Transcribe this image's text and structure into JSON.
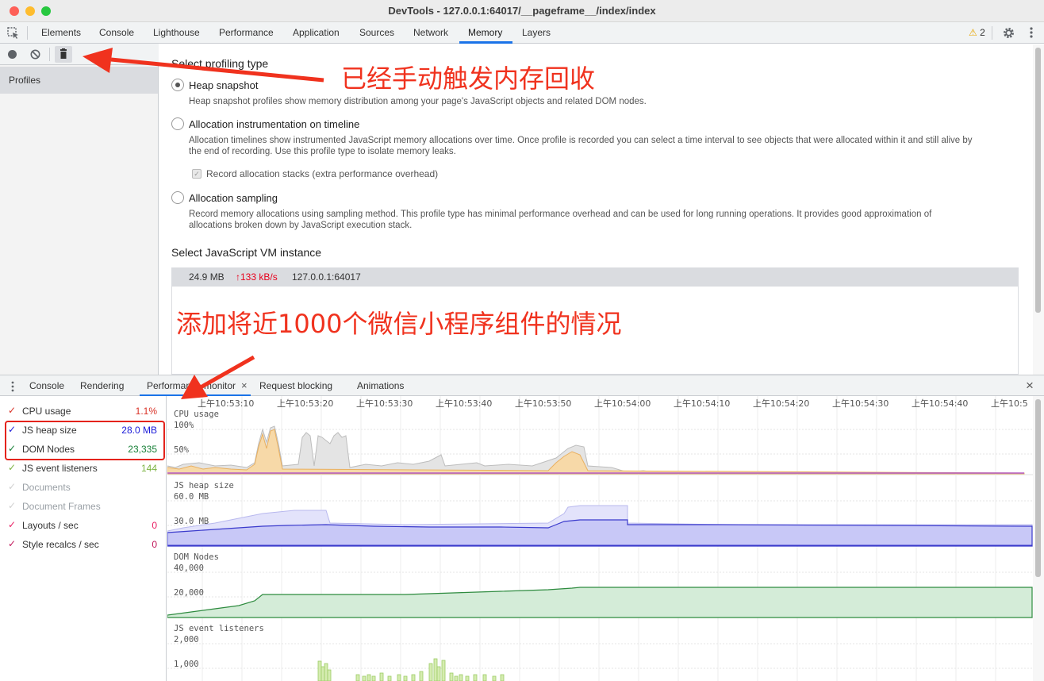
{
  "window": {
    "title": "DevTools - 127.0.0.1:64017/__pageframe__/index/index"
  },
  "main_tabs": [
    "Elements",
    "Console",
    "Lighthouse",
    "Performance",
    "Application",
    "Sources",
    "Network",
    "Memory",
    "Layers"
  ],
  "active_tab": "Memory",
  "warnings": {
    "count": "2"
  },
  "sidebar": {
    "profiles_label": "Profiles"
  },
  "memory": {
    "heading": "Select profiling type",
    "options": [
      {
        "label": "Heap snapshot",
        "checked": true,
        "desc": [
          "Heap snapshot profiles show memory distribution among your page's JavaScript objects and related DOM nodes."
        ]
      },
      {
        "label": "Allocation instrumentation on timeline",
        "checked": false,
        "desc": [
          "Allocation timelines show instrumented JavaScript memory allocations over time. Once profile is recorded you can select a time interval to see objects that were allocated within it and still alive by",
          "the end of recording. Use this profile type to isolate memory leaks."
        ]
      },
      {
        "label": "Allocation sampling",
        "checked": false,
        "desc": [
          "Record memory allocations using sampling method. This profile type has minimal performance overhead and can be used for long running operations. It provides good approximation of",
          "allocations broken down by JavaScript execution stack."
        ]
      }
    ],
    "record_stacks_label": "Record allocation stacks (extra performance overhead)",
    "vm_heading": "Select JavaScript VM instance",
    "vm": {
      "size": "24.9 MB",
      "rate": "↑133 kB/s",
      "host": "127.0.0.1:64017"
    }
  },
  "annotations": {
    "gc_note": "已经手动触发内存回收",
    "components_note": "添加将近1000个微信小程序组件的情况"
  },
  "drawer": {
    "tabs": [
      "Console",
      "Rendering",
      "Performance monitor",
      "Request blocking",
      "Animations"
    ],
    "active_tab": "Performance monitor"
  },
  "metrics": [
    {
      "label": "CPU usage",
      "value": "1.1%",
      "color": "#d93025",
      "enabled": true
    },
    {
      "label": "JS heap size",
      "value": "28.0 MB",
      "color": "#1a1ad9",
      "enabled": true
    },
    {
      "label": "DOM Nodes",
      "value": "23,335",
      "color": "#188038",
      "enabled": true
    },
    {
      "label": "JS event listeners",
      "value": "144",
      "color": "#7cb342",
      "enabled": true
    },
    {
      "label": "Documents",
      "value": "",
      "color": "#bbbbbb",
      "enabled": false
    },
    {
      "label": "Document Frames",
      "value": "",
      "color": "#bbbbbb",
      "enabled": false
    },
    {
      "label": "Layouts / sec",
      "value": "0",
      "color": "#e91e63",
      "enabled": true
    },
    {
      "label": "Style recalcs / sec",
      "value": "0",
      "color": "#c2185b",
      "enabled": true
    }
  ],
  "timeline": {
    "time_labels": [
      "上午10:53:10",
      "上午10:53:20",
      "上午10:53:30",
      "上午10:53:40",
      "上午10:53:50",
      "上午10:54:00",
      "上午10:54:10",
      "上午10:54:20",
      "上午10:54:30",
      "上午10:54:40",
      "上午10:5"
    ],
    "panes": [
      {
        "title": "CPU usage",
        "ticks": [
          "100%",
          "50%"
        ]
      },
      {
        "title": "JS heap size",
        "ticks": [
          "60.0 MB",
          "30.0 MB"
        ]
      },
      {
        "title": "DOM Nodes",
        "ticks": [
          "40,000",
          "20,000"
        ]
      },
      {
        "title": "JS event listeners",
        "ticks": [
          "2,000",
          "1,000"
        ]
      }
    ]
  }
}
